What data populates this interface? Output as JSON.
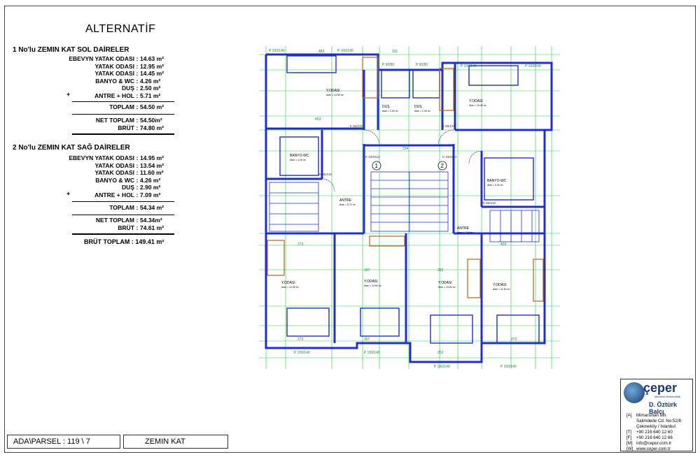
{
  "title": "ALTERNATİF",
  "section1": {
    "heading": "1  No'lu ZEMIN KAT SOL DAİRELER",
    "rows": [
      {
        "label": "EBEVYN YATAK ODASI",
        "value": "14.63 m²"
      },
      {
        "label": "YATAK ODASI",
        "value": "12.95 m²"
      },
      {
        "label": "YATAK ODASI",
        "value": "14.45 m²"
      },
      {
        "label": "BANYO & WC",
        "value": "4.26 m²"
      },
      {
        "label": "DUŞ",
        "value": "2.50 m²"
      },
      {
        "label": "ANTRE + HOL",
        "value": "5.71 m²"
      }
    ],
    "plus": "+",
    "toplam_label": "TOPLAM",
    "toplam_value": "54.50 m²",
    "net_label": "NET TOPLAM",
    "net_value": "54.50m²",
    "brut_label": "BRÜT",
    "brut_value": "74.80 m²"
  },
  "section2": {
    "heading": "2  No'lu ZEMIN KAT SAĞ DAİRELER",
    "rows": [
      {
        "label": "EBEVYN YATAK ODASI",
        "value": "14.95 m²"
      },
      {
        "label": "YATAK ODASI",
        "value": "13.54 m²"
      },
      {
        "label": "YATAK ODASI",
        "value": "11.60 m²"
      },
      {
        "label": "BANYO & WC",
        "value": "4.26 m²"
      },
      {
        "label": "DUŞ",
        "value": "2.90 m²"
      },
      {
        "label": "ANTRE + HOL",
        "value": "7.09 m²"
      }
    ],
    "plus": "+",
    "toplam_label": "TOPLAM",
    "toplam_value": "54.34 m²",
    "net_label": "NET TOPLAM",
    "net_value": "54.34m²",
    "brut_label": "BRÜT",
    "brut_value": "74.61 m²"
  },
  "grand_total": "BRÜT TOPLAM :  149.41 m²",
  "parcel": "ADA\\PARSEL :  119 \\ 7",
  "floor": "ZEMIN KAT",
  "plan": {
    "rooms": [
      {
        "name": "Y.ODASI",
        "sub": "Alan = 14.95 m²"
      },
      {
        "name": "Y.ODASI",
        "sub": "Alan = 15.45 m²"
      },
      {
        "name": "DUŞ",
        "sub": "Alan = 2.50 m²"
      },
      {
        "name": "DUŞ",
        "sub": "Alan = 2.90 m²"
      },
      {
        "name": "BANYO-WC",
        "sub": "Alan = 4.26 m²"
      },
      {
        "name": "BANYO-WC",
        "sub": "Alan = 4.26 m²"
      },
      {
        "name": "ANTRE",
        "sub": "Alan = 5.71 m²"
      },
      {
        "name": "ANTRE",
        "sub": "Alan = 7.09 m²"
      },
      {
        "name": "Y.ODASI",
        "sub": "Alan = 12.95 m²"
      },
      {
        "name": "Y.ODASI",
        "sub": "Alan = 14.63 m²"
      },
      {
        "name": "Y.ODASI",
        "sub": "Alan = 13.54 m²"
      },
      {
        "name": "Y.ODASI",
        "sub": "Alan = 11.60 m²"
      }
    ],
    "marker1": "1",
    "marker2": "2",
    "window_labels": [
      "P 100/140",
      "P 100/140",
      "P 60/60",
      "P 60/60",
      "P 100/140",
      "P 100/140",
      "P 150/140",
      "P 150/140",
      "P 150/140",
      "P 150/140"
    ],
    "door_labels": [
      "K 80/210",
      "K 80/210",
      "K 100/210",
      "K 100/210",
      "K 80/210",
      "K 80/210"
    ],
    "dims": [
      "483",
      "291",
      "453",
      "334",
      "273",
      "307",
      "282",
      "403",
      "273",
      "307",
      "262",
      "273"
    ],
    "colors": {
      "wall": "#1f2fc8",
      "grid": "#22c84a",
      "wood": "#b5651d",
      "dim": "#1a8a2a"
    }
  },
  "logo": {
    "brand": "çeper",
    "sub": "Mimarlık Mühendislik",
    "person": "D. Öztürk Balcı",
    "lines": [
      {
        "key": "[A]",
        "text": "Mimarsinan Mh."
      },
      {
        "key": "",
        "text": "Salimdede Cd. No:52/8"
      },
      {
        "key": "",
        "text": "Çekmeköy / İstanbul"
      },
      {
        "key": "[T]",
        "text": "+90 216 640 12 60"
      },
      {
        "key": "[F]",
        "text": "+90 216 640 12 66"
      },
      {
        "key": "[M]",
        "text": "info@ceper.com.tr"
      },
      {
        "key": "[W]",
        "text": "www.ceper.com.tr"
      }
    ]
  }
}
